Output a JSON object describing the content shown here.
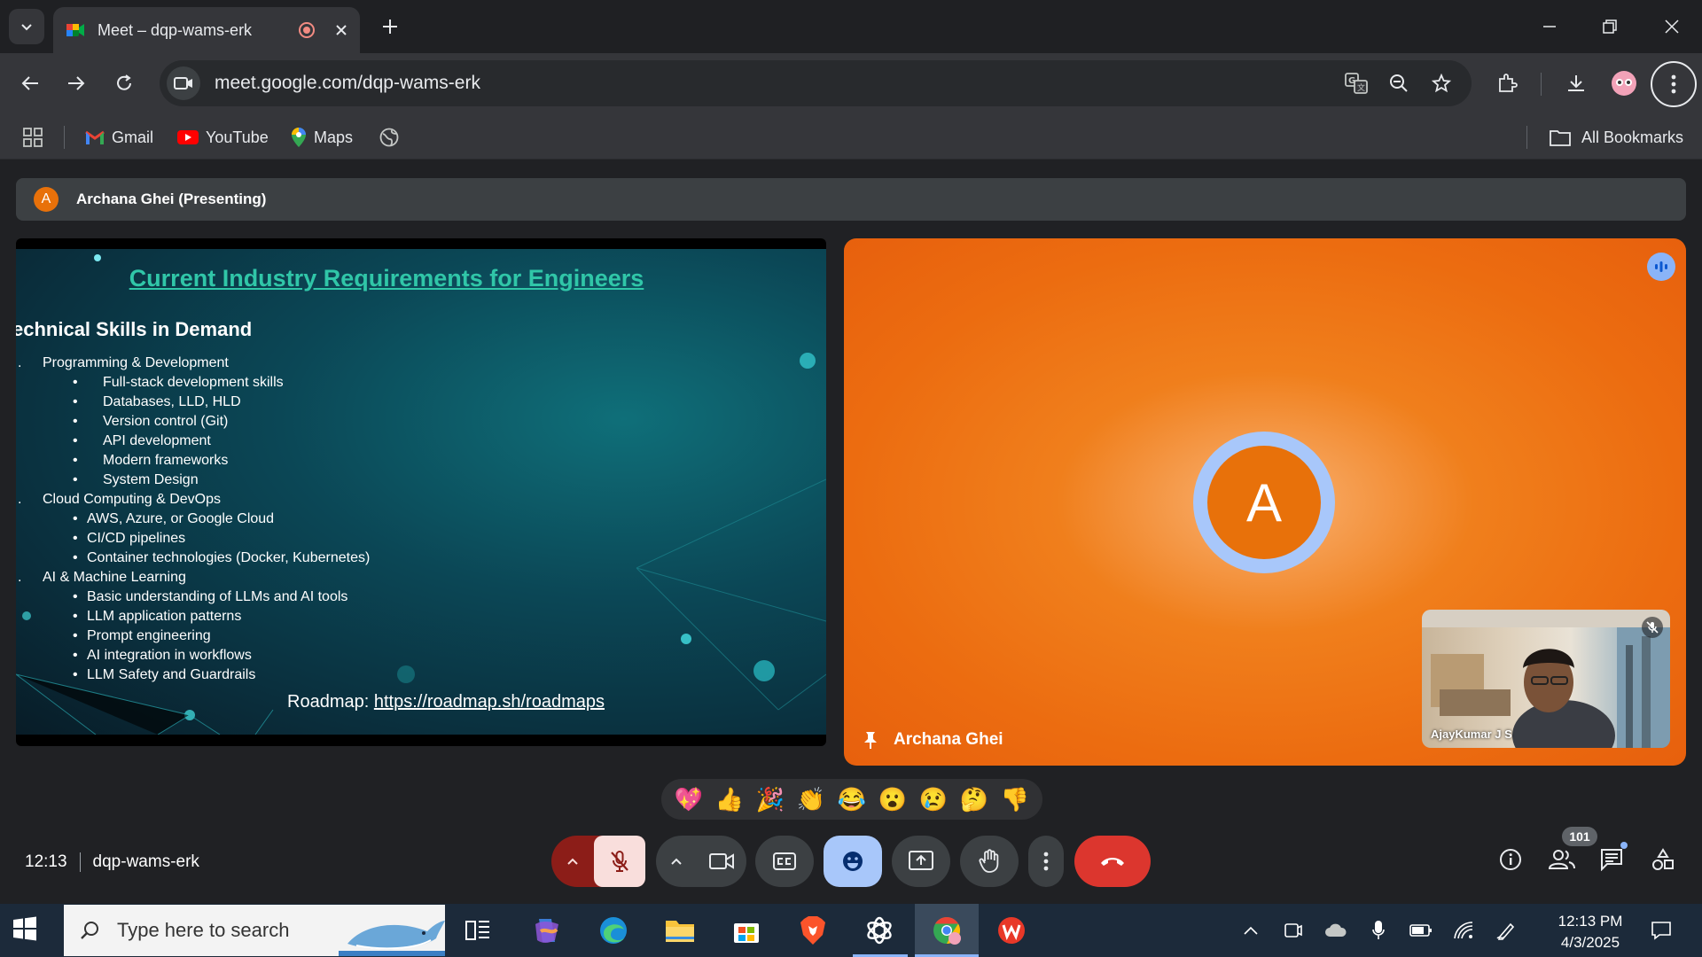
{
  "browser": {
    "tab_title": "Meet – dqp-wams-erk",
    "url": "meet.google.com/dqp-wams-erk",
    "bookmarks": [
      "Gmail",
      "YouTube",
      "Maps"
    ],
    "all_bookmarks": "All Bookmarks"
  },
  "meet": {
    "presenting_initial": "A",
    "presenting_label": "Archana Ghei (Presenting)",
    "slide": {
      "title": "Current Industry Requirements for Engineers",
      "subtitle": "echnical Skills in Demand",
      "items": [
        {
          "level": 1,
          "text": "Programming & Development"
        },
        {
          "level": 2,
          "text": "Full-stack development skills"
        },
        {
          "level": 2,
          "text": "Databases, LLD, HLD"
        },
        {
          "level": 2,
          "text": "Version control (Git)"
        },
        {
          "level": 2,
          "text": "API development"
        },
        {
          "level": 2,
          "text": "Modern frameworks"
        },
        {
          "level": 2,
          "text": "System Design"
        },
        {
          "level": 1,
          "text": "Cloud Computing & DevOps"
        },
        {
          "level": 3,
          "text": "AWS, Azure, or Google Cloud"
        },
        {
          "level": 3,
          "text": "CI/CD pipelines"
        },
        {
          "level": 3,
          "text": "Container technologies (Docker, Kubernetes)"
        },
        {
          "level": 1,
          "text": "AI & Machine Learning"
        },
        {
          "level": 3,
          "text": "Basic understanding of LLMs and AI tools"
        },
        {
          "level": 3,
          "text": "LLM application patterns"
        },
        {
          "level": 3,
          "text": "Prompt engineering"
        },
        {
          "level": 3,
          "text": "AI integration in workflows"
        },
        {
          "level": 3,
          "text": "LLM Safety and Guardrails"
        }
      ],
      "roadmap_label": "Roadmap: ",
      "roadmap_link": "https://roadmap.sh/roadmaps"
    },
    "speaker_initial": "A",
    "speaker_name": "Archana Ghei",
    "self_name": "AjayKumar J S",
    "reactions": [
      "💖",
      "👍",
      "🎉",
      "👏",
      "😂",
      "😮",
      "😢",
      "🤔",
      "👎"
    ],
    "time": "12:13",
    "meeting_code": "dqp-wams-erk",
    "participant_count": "101"
  },
  "taskbar": {
    "search_placeholder": "Type here to search",
    "time": "12:13 PM",
    "date": "4/3/2025"
  },
  "colors": {
    "accent_orange": "#e8710a",
    "end_call_red": "#ea4335",
    "emoji_active_blue": "#a8c7fa",
    "slide_title_teal": "#30c6a8"
  }
}
